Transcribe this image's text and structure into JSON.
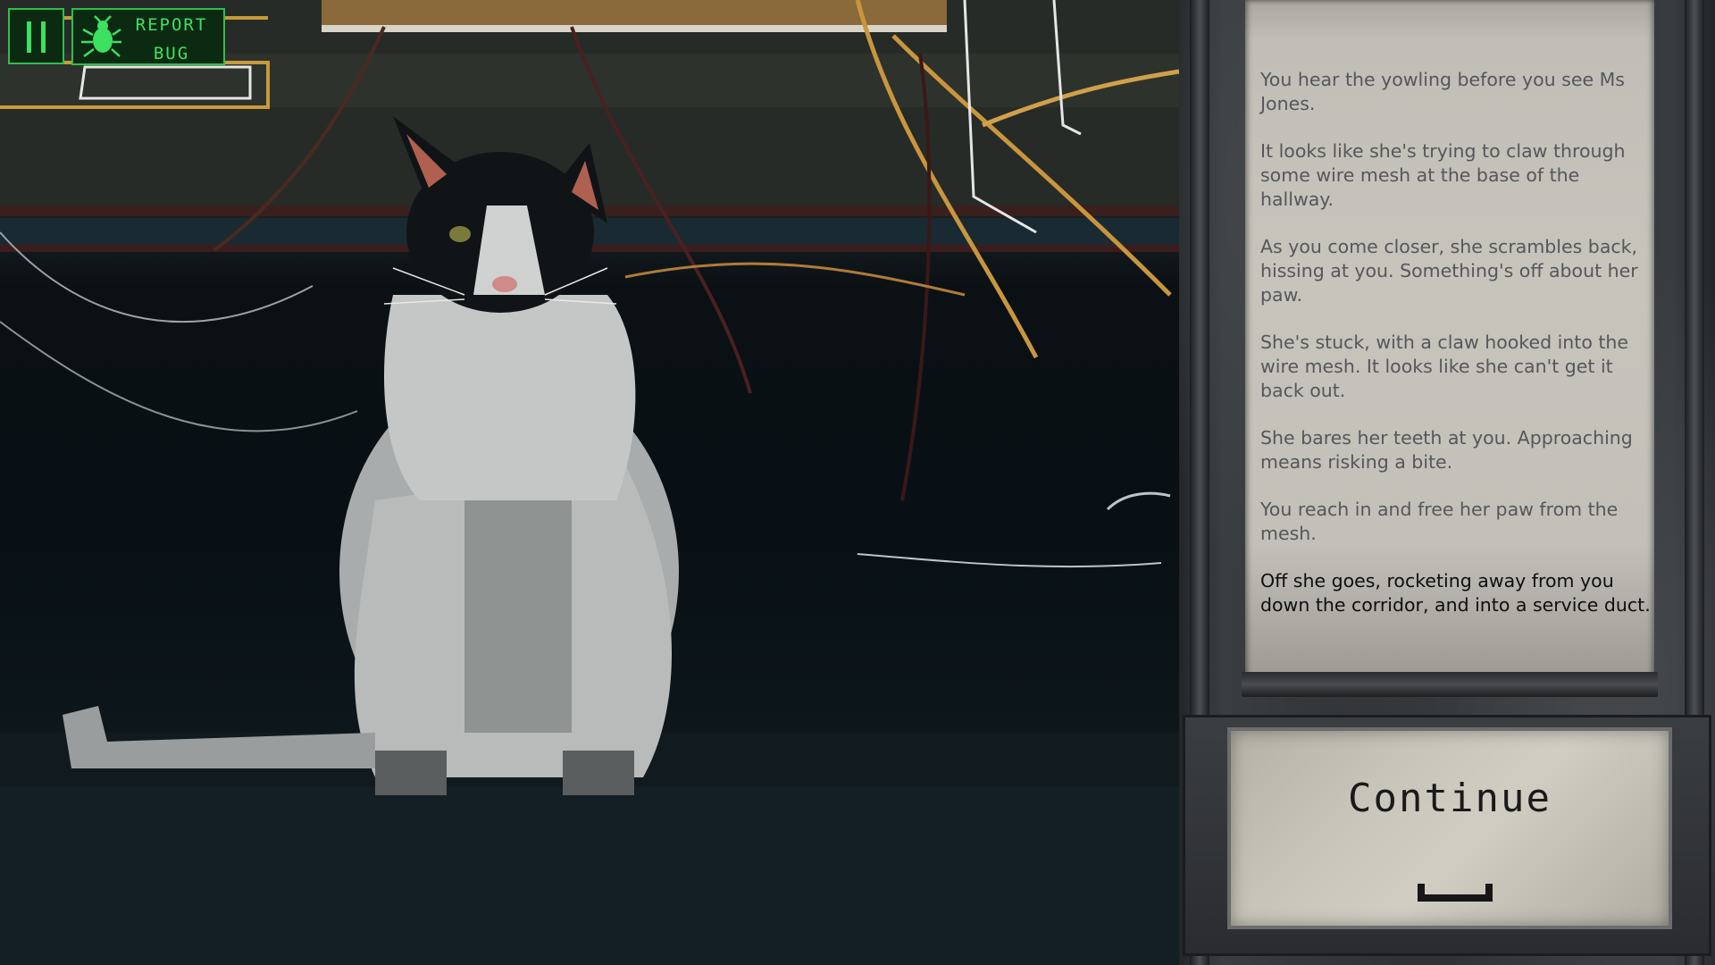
{
  "hud": {
    "pause_icon": "pause-icon",
    "report_bug": {
      "icon": "bug-icon",
      "line1": "REPORT",
      "line2": "BUG"
    },
    "accent_color": "#3ee060"
  },
  "story": {
    "paragraphs": [
      "You hear the yowling before you see Ms Jones.",
      "It looks like she's trying to claw through some wire mesh at the base of the hallway.",
      "As you come closer, she scrambles back, hissing at you. Something's off about her paw.",
      "She's stuck, with a claw hooked into the wire mesh. It looks like she can't get it back out.",
      "She bares her teeth at you. Approaching means risking a bite.",
      "You reach in and free her paw from the mesh.",
      "Off she goes, rocketing away from you down the corridor, and into a service duct."
    ]
  },
  "continue": {
    "label": "Continue",
    "key_icon": "space-key-icon"
  }
}
